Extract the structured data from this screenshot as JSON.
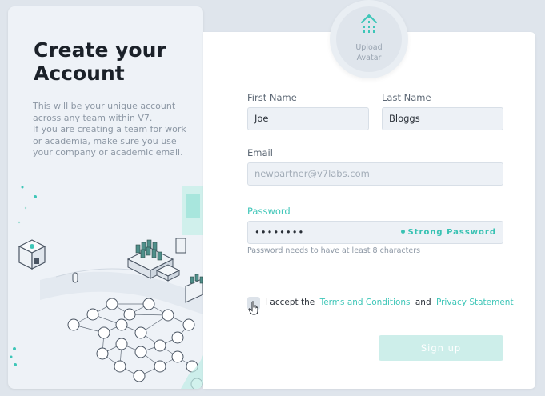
{
  "left": {
    "title_line1": "Create your",
    "title_line2": "Account",
    "desc_line1": "This will be your unique account",
    "desc_line2": "across any team within V7.",
    "desc_line3": "If you are creating a team for work",
    "desc_line4": "or academia, make sure you use",
    "desc_line5": "your company or academic email."
  },
  "avatar": {
    "label_line1": "Upload",
    "label_line2": "Avatar",
    "icon": "upload-arrow-icon"
  },
  "form": {
    "first_name": {
      "label": "First Name",
      "value": "Joe"
    },
    "last_name": {
      "label": "Last Name",
      "value": "Bloggs"
    },
    "email": {
      "label": "Email",
      "placeholder": "newpartner@v7labs.com"
    },
    "password": {
      "label": "Password",
      "value": "••••••••",
      "strength": "Strong Password",
      "hint": "Password needs to have at least 8 characters"
    },
    "accept": {
      "prefix": "I accept the",
      "terms_link": "Terms and Conditions",
      "and": "and",
      "privacy_link": "Privacy Statement"
    },
    "signup_label": "Sign up"
  },
  "colors": {
    "accent": "#3ec6b8",
    "background": "#dfe5ec",
    "card": "#ffffff",
    "panel": "#eef2f7"
  }
}
